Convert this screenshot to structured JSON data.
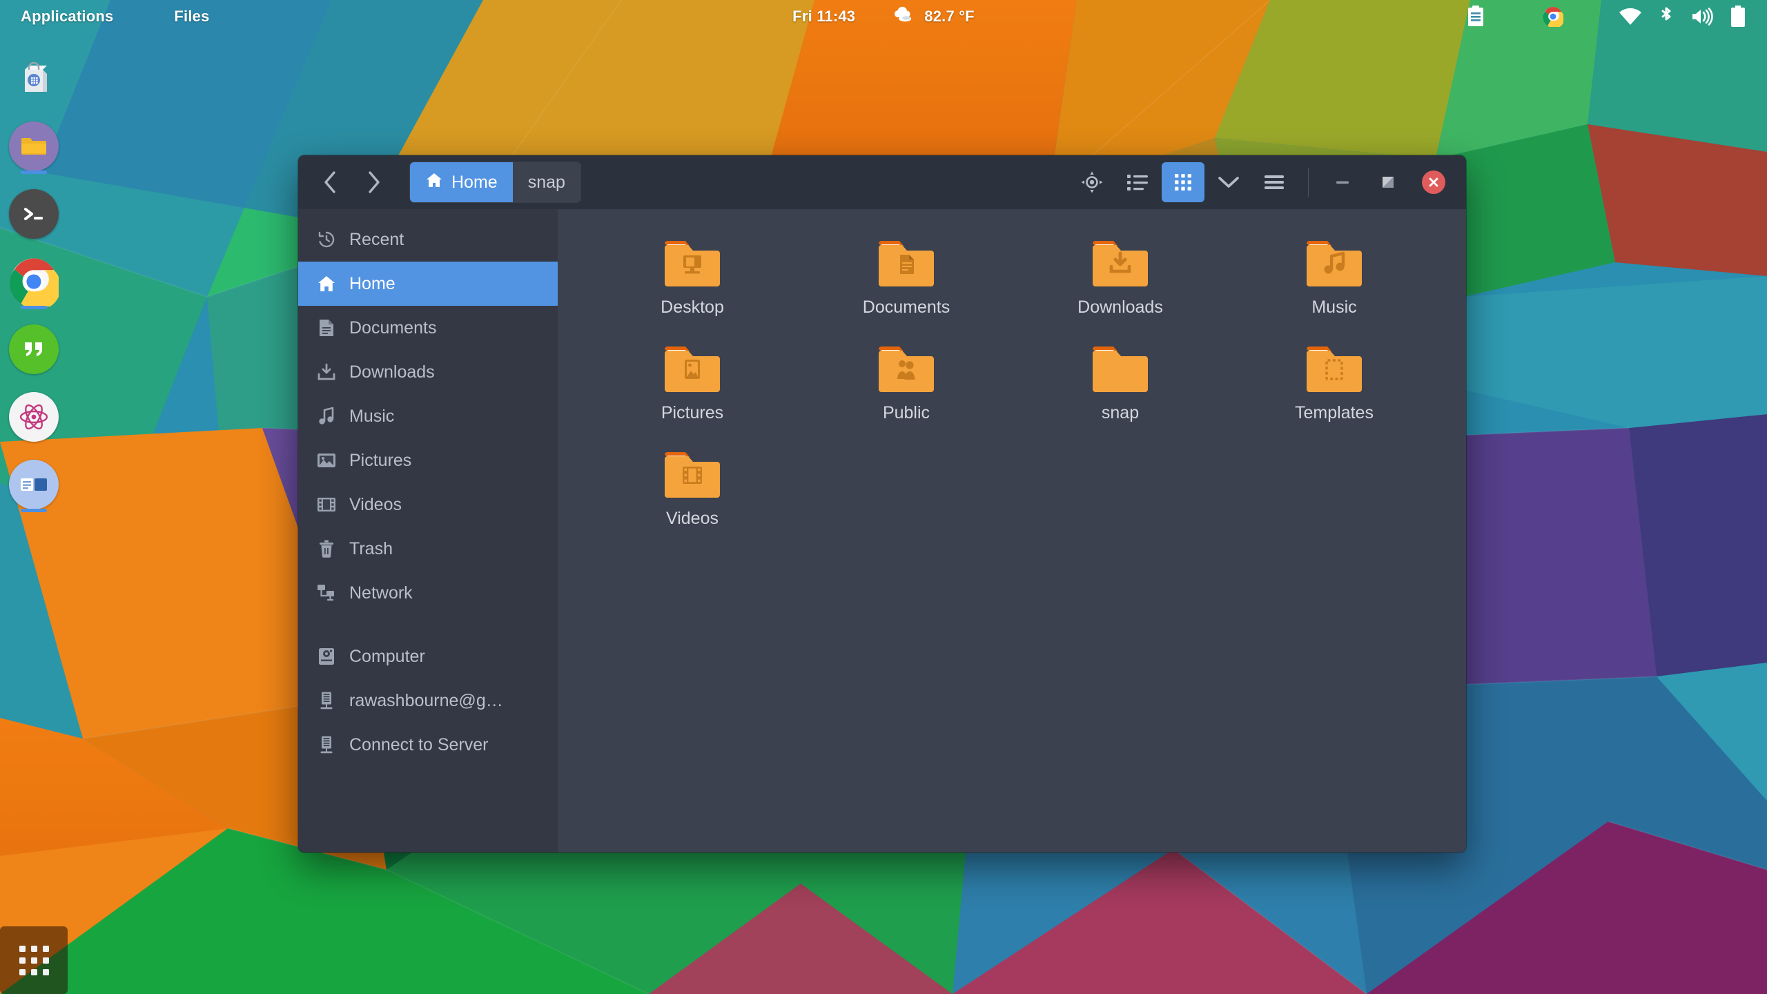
{
  "topbar": {
    "applications_label": "Applications",
    "files_label": "Files",
    "clock": "Fri 11:43",
    "weather_icon": "cloud-icon",
    "temperature": "82.7 °F",
    "tray": [
      {
        "name": "clipboard-icon",
        "label": "Clipboard"
      },
      {
        "name": "chrome-icon",
        "label": "Chrome"
      },
      {
        "name": "wifi-icon",
        "label": "Wi-Fi"
      },
      {
        "name": "bluetooth-icon",
        "label": "Bluetooth"
      },
      {
        "name": "volume-icon",
        "label": "Volume"
      },
      {
        "name": "battery-icon",
        "label": "Battery"
      }
    ]
  },
  "dock": {
    "items": [
      {
        "name": "software-center-icon",
        "label": "Software",
        "running": false
      },
      {
        "name": "files-icon",
        "label": "Files",
        "running": true
      },
      {
        "name": "terminal-icon",
        "label": "Terminal",
        "running": false
      },
      {
        "name": "chrome-icon",
        "label": "Google Chrome",
        "running": true
      },
      {
        "name": "hangouts-icon",
        "label": "Hangouts",
        "running": false
      },
      {
        "name": "atom-icon",
        "label": "Atom",
        "running": false
      },
      {
        "name": "slides-icon",
        "label": "Presentation",
        "running": true
      }
    ],
    "launcher_label": "Show Applications"
  },
  "window": {
    "title": "Home",
    "back_label": "Back",
    "forward_label": "Forward",
    "breadcrumbs": [
      {
        "label": "Home",
        "icon": "home-icon",
        "active": true
      },
      {
        "label": "snap",
        "icon": "",
        "active": false
      }
    ],
    "tools": [
      {
        "name": "location-icon",
        "label": "Search / Locate",
        "active": false
      },
      {
        "name": "list-view-icon",
        "label": "List View",
        "active": false
      },
      {
        "name": "grid-view-icon",
        "label": "Grid View",
        "active": true
      },
      {
        "name": "chevron-down-icon",
        "label": "View Options",
        "active": false
      },
      {
        "name": "hamburger-menu-icon",
        "label": "Menu",
        "active": false
      }
    ],
    "controls": [
      {
        "name": "minimize-button",
        "label": "Minimize"
      },
      {
        "name": "maximize-button",
        "label": "Maximize"
      },
      {
        "name": "close-button",
        "label": "Close"
      }
    ]
  },
  "sidebar": {
    "items": [
      {
        "label": "Recent",
        "icon": "recent-clock-icon",
        "active": false
      },
      {
        "label": "Home",
        "icon": "home-icon",
        "active": true
      },
      {
        "label": "Documents",
        "icon": "document-icon",
        "active": false
      },
      {
        "label": "Downloads",
        "icon": "download-icon",
        "active": false
      },
      {
        "label": "Music",
        "icon": "music-note-icon",
        "active": false
      },
      {
        "label": "Pictures",
        "icon": "picture-icon",
        "active": false
      },
      {
        "label": "Videos",
        "icon": "film-icon",
        "active": false
      },
      {
        "label": "Trash",
        "icon": "trash-icon",
        "active": false
      },
      {
        "label": "Network",
        "icon": "network-icon",
        "active": false
      }
    ],
    "items2": [
      {
        "label": "Computer",
        "icon": "computer-icon",
        "active": false
      },
      {
        "label": "rawashbourne@g…",
        "icon": "server-icon",
        "active": false
      },
      {
        "label": "Connect to Server",
        "icon": "server-icon",
        "active": false
      }
    ]
  },
  "files": [
    {
      "name": "Desktop",
      "icon": "folder-desktop-icon"
    },
    {
      "name": "Documents",
      "icon": "folder-documents-icon"
    },
    {
      "name": "Downloads",
      "icon": "folder-downloads-icon"
    },
    {
      "name": "Music",
      "icon": "folder-music-icon"
    },
    {
      "name": "Pictures",
      "icon": "folder-pictures-icon"
    },
    {
      "name": "Public",
      "icon": "folder-public-icon"
    },
    {
      "name": "snap",
      "icon": "folder-plain-icon"
    },
    {
      "name": "Templates",
      "icon": "folder-templates-icon"
    },
    {
      "name": "Videos",
      "icon": "folder-videos-icon"
    }
  ],
  "colors": {
    "accent": "#5294e2",
    "window_header": "#2c323d",
    "sidebar_bg": "#333844",
    "content_bg": "#3b414e",
    "folder_orange": "#f5a33c",
    "folder_tab": "#e4650a",
    "close_red": "#e05c5c"
  }
}
